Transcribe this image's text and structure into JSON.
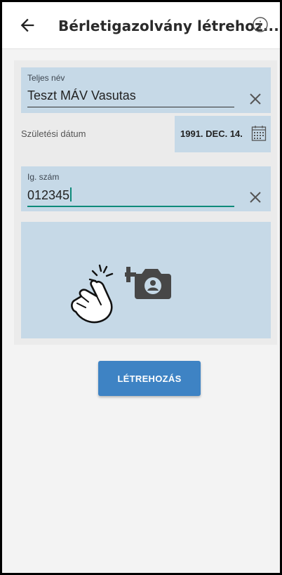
{
  "appbar": {
    "title": "Bérletigazolvány létrehoz...",
    "back_icon": "arrow-left-icon",
    "info_icon": "info-circle-icon"
  },
  "form": {
    "full_name": {
      "label": "Teljes név",
      "value": "Teszt MÁV Vasutas",
      "clear_icon": "close-icon"
    },
    "birth_date": {
      "label": "Születési dátum",
      "value": "1991. DEC. 14.",
      "icon": "calendar-icon"
    },
    "id_number": {
      "label": "Ig. szám",
      "value": "012345",
      "clear_icon": "close-icon"
    },
    "photo": {
      "icon": "add-photo-icon",
      "hint_icon": "tap-hand-icon"
    }
  },
  "actions": {
    "create_label": "LÉTREHOZÁS"
  },
  "colors": {
    "field_bg": "#c6d9e7",
    "accent": "#3e83c4",
    "cursor": "#0d8a7a"
  }
}
